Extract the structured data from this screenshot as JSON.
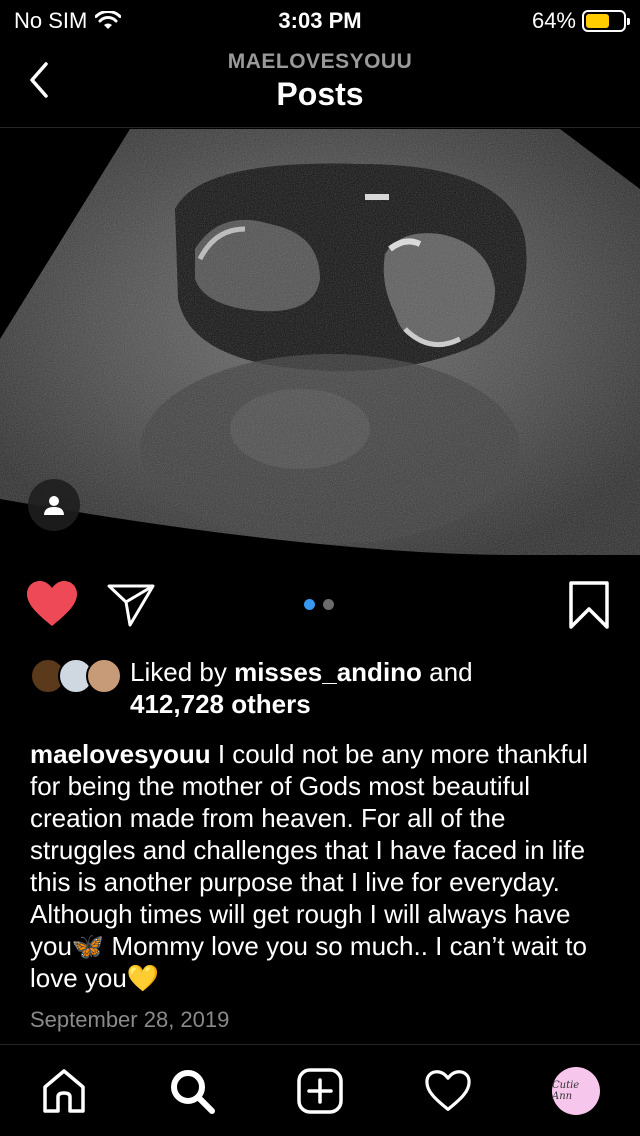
{
  "status_bar": {
    "carrier": "No SIM",
    "time": "3:03 PM",
    "battery_percent": "64%",
    "battery_level": 0.64,
    "battery_color": "#ffcc00",
    "wifi_icon": "wifi-icon"
  },
  "header": {
    "username": "MAELOVESYOUU",
    "title": "Posts"
  },
  "post": {
    "carousel": {
      "count": 2,
      "active_index": 0
    },
    "liked": true,
    "like_color": "#ed4956",
    "likes": {
      "prefix": "Liked by ",
      "user": "misses_andino",
      "connector": " and",
      "count": "412,728 others"
    },
    "caption": {
      "username": "maelovesyouu",
      "text": " I could not be any more thankful for being the mother of Gods most beautiful creation made from heaven. For all of the struggles and challenges that I have faced in life this is another purpose that I live for everyday. Although times will get rough I will always have you🦋 Mommy love you so much.. I can’t wait to love you💛"
    },
    "date": "September 28, 2019"
  },
  "tab_bar": {
    "items": [
      "home-icon",
      "search-icon",
      "new-post-icon",
      "activity-heart-icon",
      "profile-avatar"
    ],
    "profile_text": "Cutie Ann"
  }
}
